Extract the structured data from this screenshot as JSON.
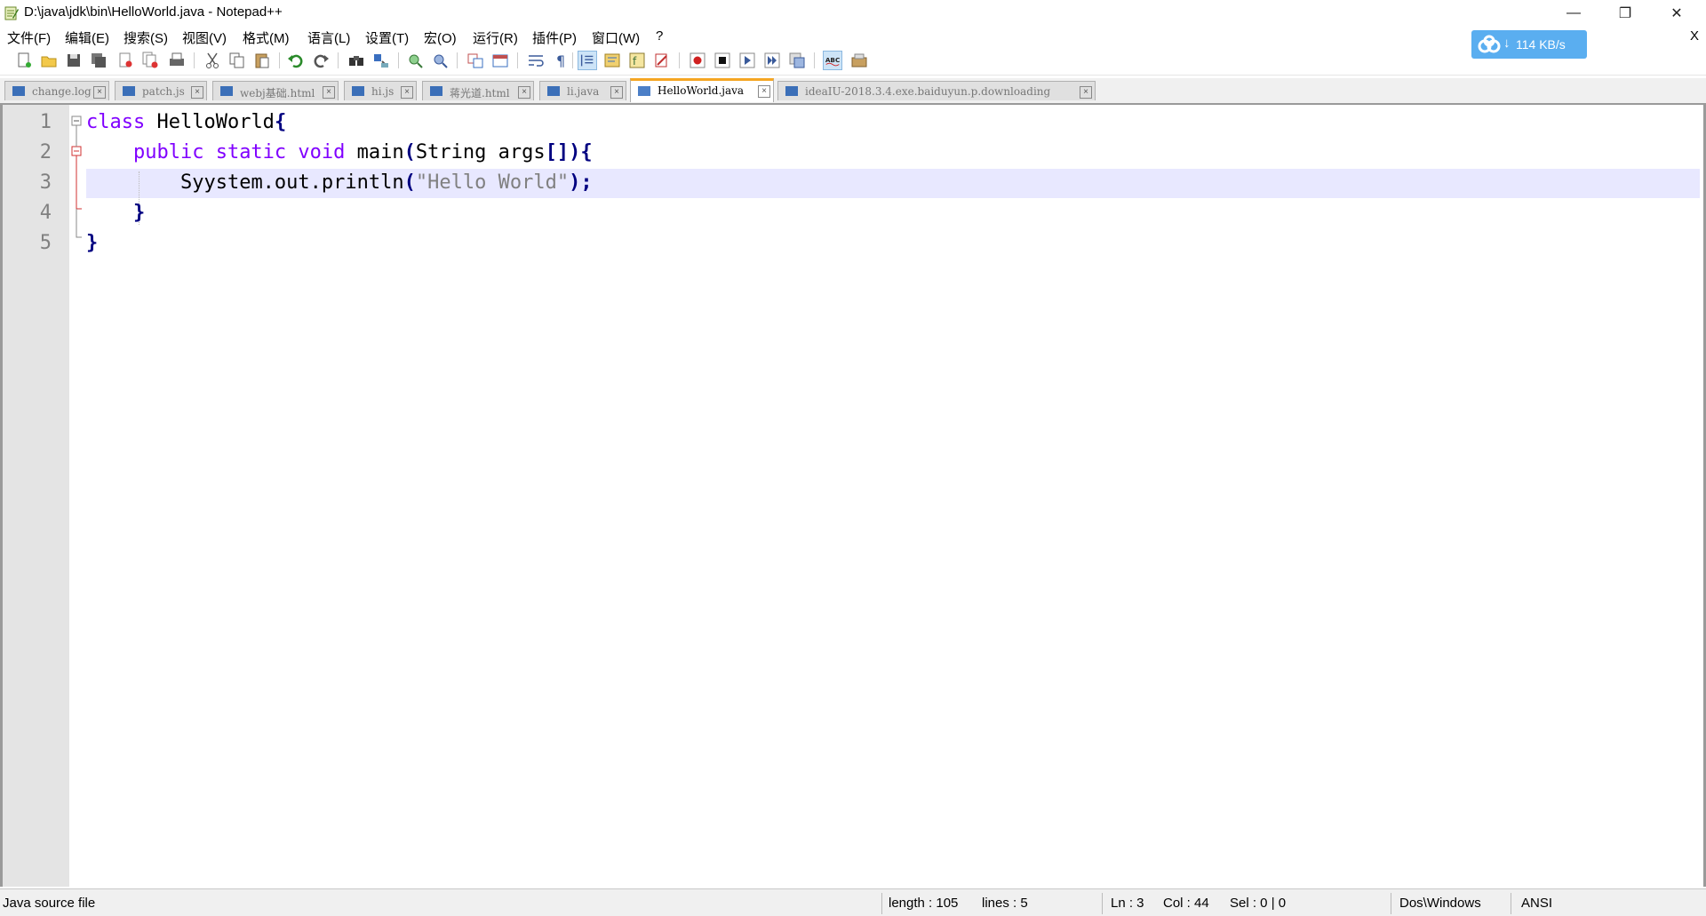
{
  "window": {
    "title": "D:\\java\\jdk\\bin\\HelloWorld.java - Notepad++",
    "minimize": "—",
    "restore": "❐",
    "close": "✕"
  },
  "menu": {
    "items": [
      "文件(F)",
      "编辑(E)",
      "搜索(S)",
      "视图(V)",
      "格式(M)",
      "语言(L)",
      "设置(T)",
      "宏(O)",
      "运行(R)",
      "插件(P)",
      "窗口(W)",
      "?"
    ],
    "close_label": "X"
  },
  "download_widget": {
    "speed": "114 KB/s",
    "color": "#5aaef0"
  },
  "toolbar": {
    "icons": [
      "new-file-icon",
      "open-file-icon",
      "save-icon",
      "save-all-icon",
      "close-icon",
      "close-all-icon",
      "print-icon",
      "cut-icon",
      "copy-icon",
      "paste-icon",
      "undo-icon",
      "redo-icon",
      "find-icon",
      "replace-icon",
      "zoom-in-icon",
      "zoom-out-icon",
      "sync-vertical-icon",
      "sync-horizontal-icon",
      "word-wrap-icon",
      "show-all-chars-icon",
      "indent-guide-icon",
      "doc-map-icon",
      "function-list-icon",
      "folder-workspace-icon",
      "record-macro-icon",
      "stop-macro-icon",
      "play-macro-icon",
      "run-macro-multiple-icon",
      "save-macro-icon",
      "spellcheck-icon",
      "plugin-icon"
    ]
  },
  "tabs": [
    {
      "label": "change.log",
      "active": false
    },
    {
      "label": "patch.js",
      "active": false
    },
    {
      "label": "webj基础.html",
      "active": false
    },
    {
      "label": "hi.js",
      "active": false
    },
    {
      "label": "蒋光道.html",
      "active": false
    },
    {
      "label": "li.java",
      "active": false
    },
    {
      "label": "HelloWorld.java",
      "active": true
    },
    {
      "label": "ideaIU-2018.3.4.exe.baiduyun.p.downloading",
      "active": false
    }
  ],
  "editor": {
    "line_numbers": [
      "1",
      "2",
      "3",
      "4",
      "5"
    ],
    "current_line": 3,
    "code": {
      "l1_kw": "class",
      "l1_rest": " HelloWorld",
      "l1_brace": "{",
      "l2_indent": "    ",
      "l2_kw": "public static void",
      "l2_rest1": " main",
      "l2_p1": "(",
      "l2_rest2": "String args",
      "l2_br": "[]",
      "l2_p2": ")",
      "l2_brace": "{",
      "l3_indent": "        ",
      "l3_rest1": "Syystem.out.println",
      "l3_p1": "(",
      "l3_str": "\"Hello World\"",
      "l3_p2": ");",
      "l4_indent": "    ",
      "l4_brace": "}",
      "l5_brace": "}"
    }
  },
  "status": {
    "file_type": "Java source file",
    "length": "length : 105",
    "lines": "lines : 5",
    "ln": "Ln : 3",
    "col": "Col : 44",
    "sel": "Sel : 0 | 0",
    "eol": "Dos\\Windows",
    "encoding": "ANSI"
  }
}
